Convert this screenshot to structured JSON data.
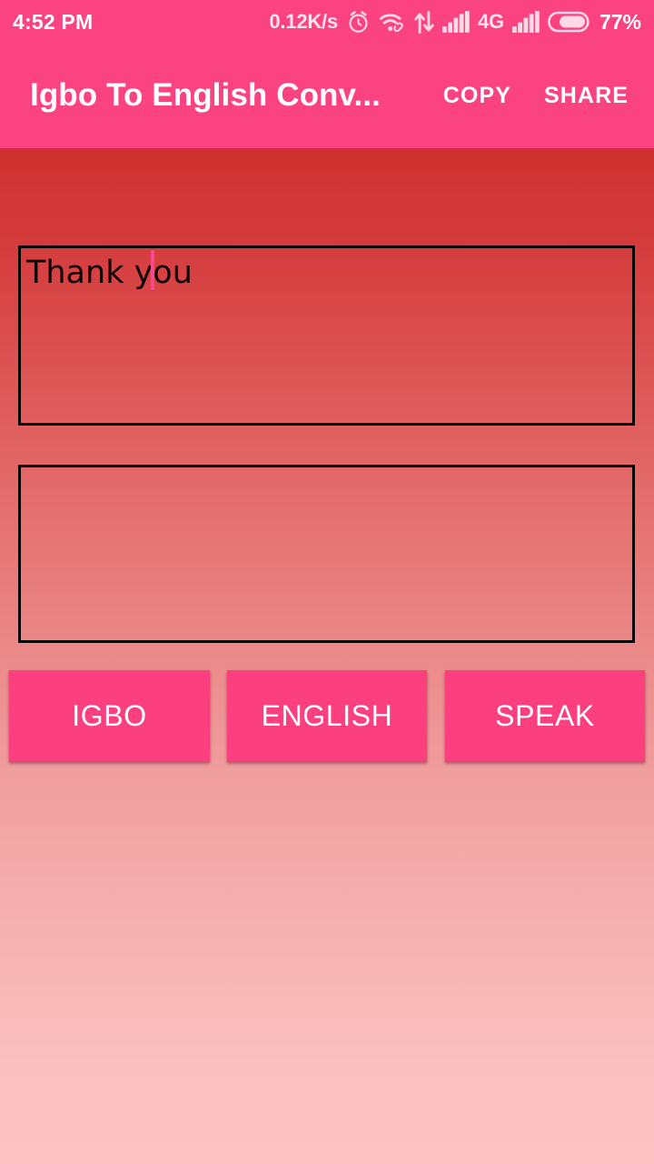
{
  "status_bar": {
    "time": "4:52 PM",
    "network_speed": "0.12K/s",
    "battery_percent": "77%",
    "icons": [
      "alarm-clock-icon",
      "wifi-icon",
      "data-transfer-icon",
      "signal-bars-icon",
      "signal-bars-secondary-icon",
      "battery-icon"
    ],
    "network_type": "4G",
    "background_color": "#fb4381",
    "foreground_color": "#ffffff"
  },
  "app_bar": {
    "title": "Igbo To English Conv...",
    "copy_label": "COPY",
    "share_label": "SHARE",
    "background_color": "#fb4381",
    "text_color": "#ffffff"
  },
  "main": {
    "input_box": {
      "value": "Thank you",
      "placeholder": "",
      "border_color": "#0a0000",
      "cursor_color": "#f8498a"
    },
    "output_box": {
      "value": "",
      "placeholder": "",
      "border_color": "#0a0000"
    },
    "background_gradient_top": "#cf3030",
    "background_gradient_bottom": "#fdc2c2"
  },
  "buttons": {
    "accent_color": "#fb3f7f",
    "text_color": "#ffffff",
    "items": [
      {
        "label": "IGBO"
      },
      {
        "label": "ENGLISH"
      },
      {
        "label": "SPEAK"
      }
    ]
  }
}
